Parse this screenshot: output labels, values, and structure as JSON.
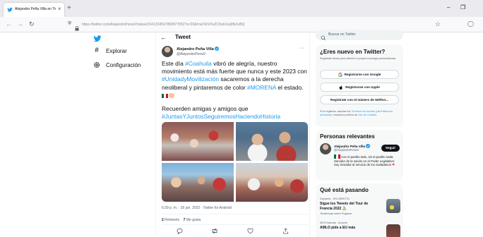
{
  "browser": {
    "tab_title": "Alejandro Peña Villa en Twitter: \"Es",
    "tab_close": "×",
    "new_tab": "+",
    "url": "https://twitter.com/AlejandroPenaV/status/1541234567890877952?s=20&t=aCW1Pw2CSokXwj0fkXxBQ",
    "minimize": "–",
    "maximize": "❐"
  },
  "twitter": {
    "nav": {
      "explore_label": "Explorar",
      "settings_label": "Configuración"
    },
    "header": {
      "back_arrow": "←",
      "title": "Tweet"
    },
    "tweet": {
      "author_name": "Alejandro Peña Villa",
      "author_handle": "@AlejandroPenaV",
      "more": "···",
      "text_1": "Este día ",
      "hashtag_coahuila": "#Coahuila",
      "text_2": " vibró de alegría, nuestro movimiento está más fuerte que nunca y este 2023 con ",
      "hashtag_unidad": "#UnidadyMovilización",
      "text_3": " sacaremos a la derecha neoliberal y pintaremos de color ",
      "hashtag_morena": "#MORENA",
      "text_4": " el estado.",
      "paragraph2_text": "Recuerden amigas y amigos que ",
      "hashtag_juntas": "#JuntasYJuntosSeguiremosHaciendoHistoria",
      "meta": "6:39 p. m. · 26 jun. 2022 · Twitter for Android",
      "retweets_count": "2",
      "retweets_label": " Retweets",
      "likes_count": "7",
      "likes_label": " Me gusta"
    },
    "sidebar": {
      "search_placeholder": "Buscar en Twitter",
      "signup": {
        "title": "¿Eres nuevo en Twitter?",
        "subtitle": "Regístrate ahora para obtener tu propia cronología personalizada.",
        "google_label": "Registrarse con Google",
        "apple_label": "Registrarse con Apple",
        "phone_label": "Regístrate con el número de teléfon...",
        "terms_1": "Si te registras, aceptas los ",
        "terms_link1": "Términos de servicio",
        "terms_2": " y la ",
        "terms_link2": "Política de privacidad",
        "terms_3": ", incluida la política de ",
        "terms_link3": "Uso de Cookies",
        "terms_4": "."
      },
      "relevant": {
        "title": "Personas relevantes",
        "name": "Alejandro Peña Villa",
        "handle": "@AlejandroPenaV",
        "follow_label": "Seguir",
        "bio": "Con el pueblo todo, sin el pueblo nada. Servidor de la nación en el Poder Legislativo: Soy Senador al servicio de los ciudadanos"
      },
      "trends": {
        "title": "Qué está pasando",
        "items": [
          {
            "meta": "Deportes · EN DIRECTO",
            "title": "Sigue los Tweets del Tour de Francia 2022 🚴",
            "sub": "Tendencias sobre Pogacar"
          },
          {
            "meta": "MVS Noticias · Anoche",
            "title": "AMLO pide a EU más"
          }
        ]
      }
    }
  }
}
